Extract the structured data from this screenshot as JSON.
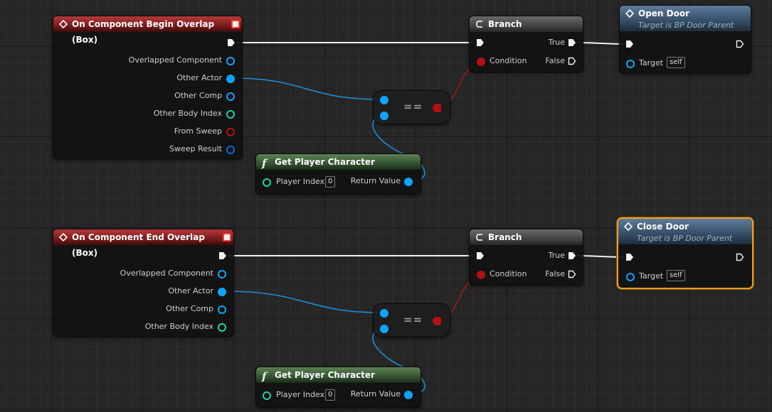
{
  "graph": {
    "top": {
      "event": {
        "title": "On Component Begin Overlap (Box)",
        "pins": [
          "Overlapped Component",
          "Other Actor",
          "Other Comp",
          "Other Body Index",
          "From Sweep",
          "Sweep Result"
        ]
      },
      "get_player": {
        "title": "Get Player Character",
        "index_label": "Player Index",
        "index_value": "0",
        "return_label": "Return Value"
      },
      "equal": {
        "symbol": "=="
      },
      "branch": {
        "title": "Branch",
        "condition": "Condition",
        "true_label": "True",
        "false_label": "False"
      },
      "call": {
        "title": "Open Door",
        "subtitle": "Target is BP Door Parent",
        "target_label": "Target",
        "target_value": "self"
      }
    },
    "bottom": {
      "event": {
        "title": "On Component End Overlap (Box)",
        "pins": [
          "Overlapped Component",
          "Other Actor",
          "Other Comp",
          "Other Body Index"
        ]
      },
      "get_player": {
        "title": "Get Player Character",
        "index_label": "Player Index",
        "index_value": "0",
        "return_label": "Return Value"
      },
      "equal": {
        "symbol": "=="
      },
      "branch": {
        "title": "Branch",
        "condition": "Condition",
        "true_label": "True",
        "false_label": "False"
      },
      "call": {
        "title": "Close Door",
        "subtitle": "Target is BP Door Parent",
        "target_label": "Target",
        "target_value": "self"
      }
    }
  },
  "colors": {
    "exec": "#f2f2f2",
    "object": "#0ea5ff",
    "integer": "#1fd2a4",
    "boolean": "#b51010",
    "struct": "#0a6ad8",
    "selection": "#f0a020"
  },
  "icons": {
    "event": "event-diamond-icon",
    "branch": "branch-icon",
    "function": "function-icon",
    "call": "call-function-icon"
  }
}
